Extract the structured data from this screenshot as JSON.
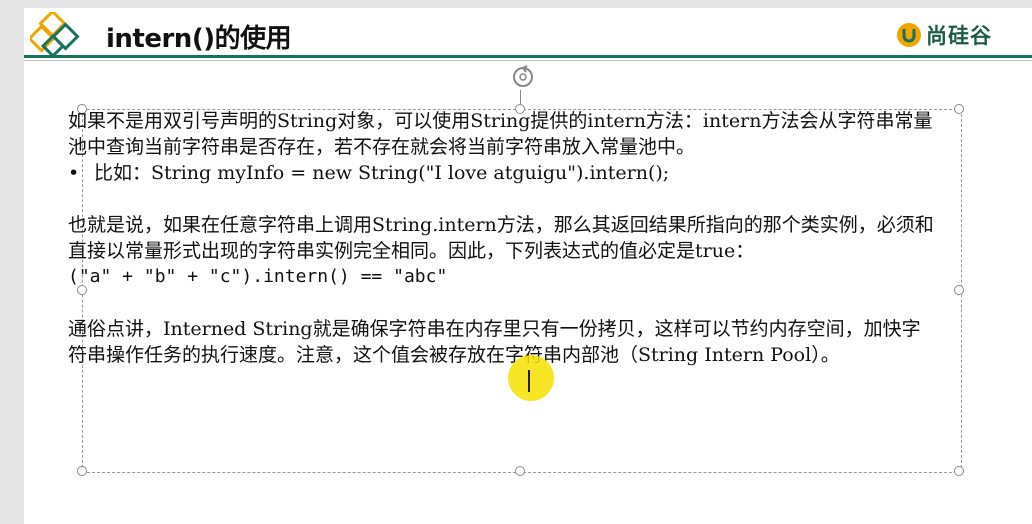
{
  "slide": {
    "title": "intern()的使用",
    "brand": "尚硅谷",
    "accent_color": "#17735e"
  },
  "body": {
    "p1": "如果不是用双引号声明的String对象，可以使用String提供的intern方法：intern方法会从字符串常量池中查询当前字符串是否存在，若不存在就会将当前字符串放入常量池中。",
    "bullet_symbol": "•",
    "bullet": "比如：String myInfo = new String(\"I love atguigu\").intern();",
    "p2": "也就是说，如果在任意字符串上调用String.intern方法，那么其返回结果所指向的那个类实例，必须和直接以常量形式出现的字符串实例完全相同。因此，下列表达式的值必定是true：",
    "code": "(\"a\" + \"b\" + \"c\").intern() == \"abc\"",
    "p3": "通俗点讲，Interned String就是确保字符串在内存里只有一份拷贝，这样可以节约内存空间，加快字符串操作任务的执行速度。注意，这个值会被存放在字符串内部池（String Intern Pool）。"
  },
  "icons": {
    "logo": "diamond-logo-icon",
    "brand_logo": "brand-u-icon",
    "rotate": "rotate-handle-icon"
  }
}
